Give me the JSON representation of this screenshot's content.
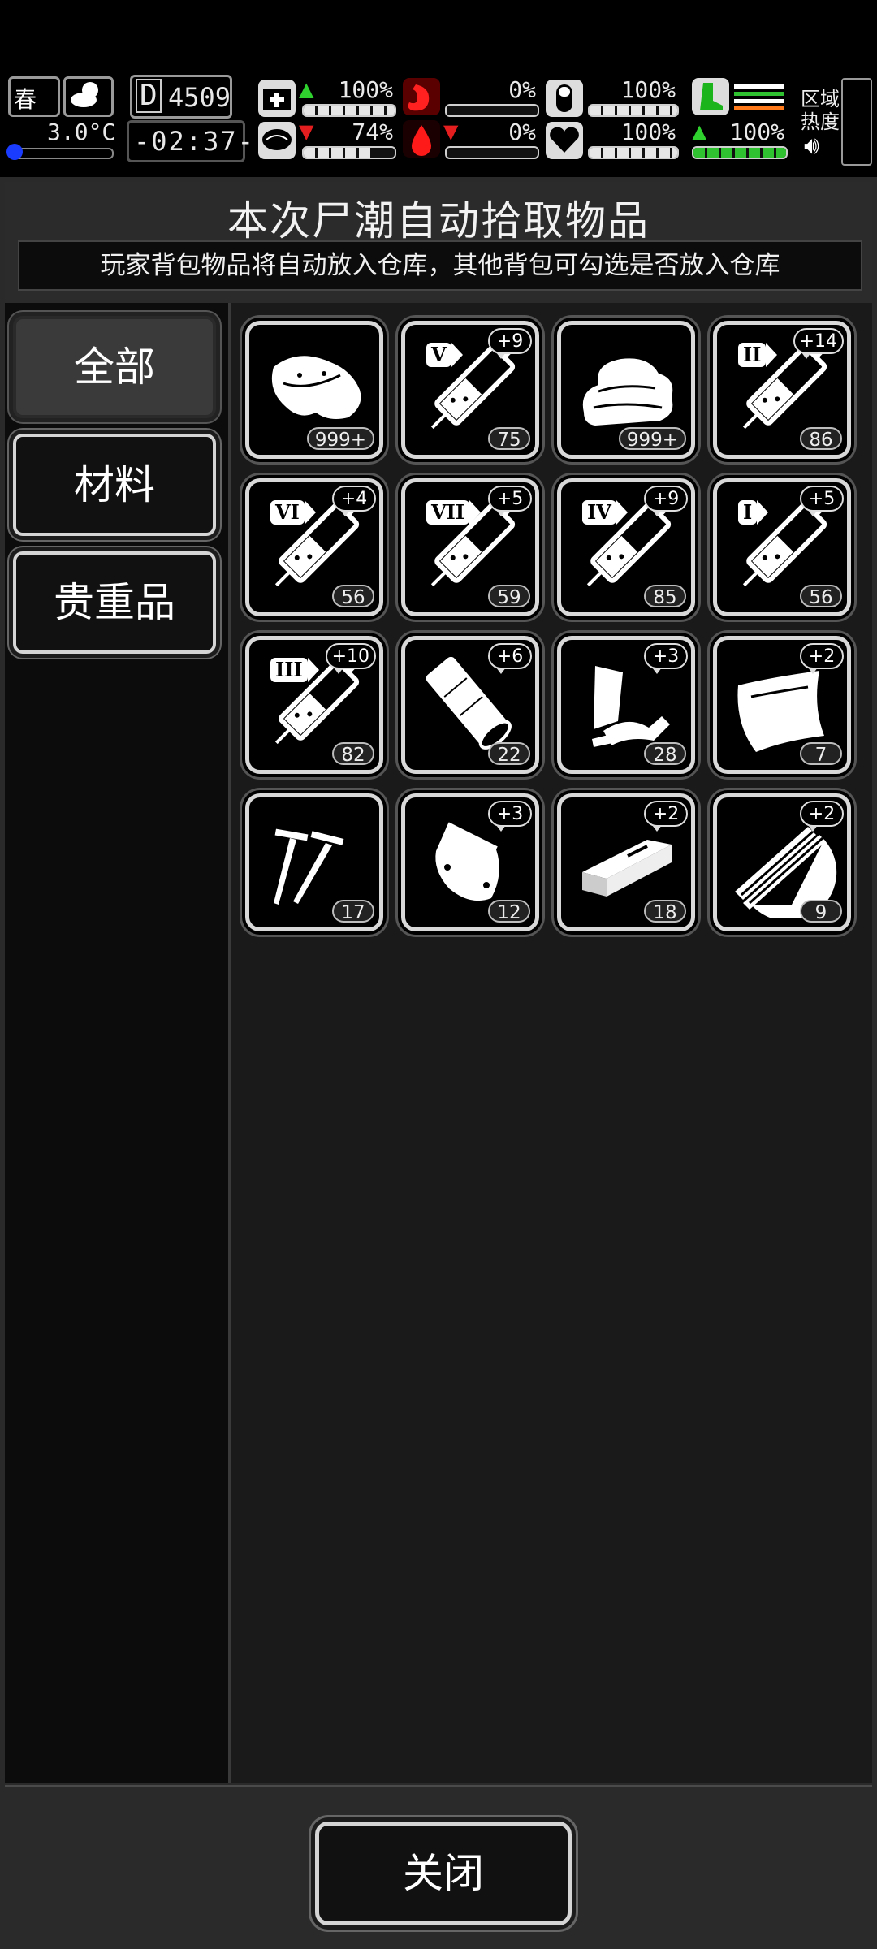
{
  "status_bar": {
    "season": "春",
    "temperature": "3.0°C",
    "day_counter": "4509",
    "day_counter_prefix": "D",
    "clock": "-02:37-",
    "health": {
      "text": "100%",
      "level": 1.0,
      "trend": "up"
    },
    "sanity": {
      "text": "74%",
      "level": 0.74,
      "trend": "down"
    },
    "hunger": {
      "text": "0%",
      "level": 0.0
    },
    "blood": {
      "text": "0%",
      "level": 0.0,
      "trend": "down"
    },
    "pill": {
      "text": "100%",
      "level": 1.0
    },
    "heart": {
      "text": "100%",
      "level": 1.0
    },
    "stamina": {
      "text": "100%",
      "level": 1.0,
      "trend": "up"
    },
    "zone_heat_label_1": "区域",
    "zone_heat_label_2": "热度",
    "colors": {
      "up_arrow": "#2fd12f",
      "down_arrow": "#e41e1e",
      "stamina_bar": "#2fc12f"
    }
  },
  "dialog": {
    "title": "本次尸潮自动拾取物品",
    "subtitle": "玩家背包物品将自动放入仓库，其他背包可勾选是否放入仓库"
  },
  "categories": [
    {
      "label": "全部",
      "active": true
    },
    {
      "label": "材料",
      "active": false
    },
    {
      "label": "贵重品",
      "active": false
    }
  ],
  "items": [
    {
      "icon": "meat-icon",
      "qty": "999+",
      "bonus": "",
      "tier": ""
    },
    {
      "icon": "syringe-icon",
      "qty": "75",
      "bonus": "+9",
      "tier": "V"
    },
    {
      "icon": "cloth-icon",
      "qty": "999+",
      "bonus": "",
      "tier": ""
    },
    {
      "icon": "syringe-icon",
      "qty": "86",
      "bonus": "+14",
      "tier": "II"
    },
    {
      "icon": "syringe-icon",
      "qty": "56",
      "bonus": "+4",
      "tier": "VI"
    },
    {
      "icon": "syringe-icon",
      "qty": "59",
      "bonus": "+5",
      "tier": "VII"
    },
    {
      "icon": "syringe-icon",
      "qty": "85",
      "bonus": "+9",
      "tier": "IV"
    },
    {
      "icon": "syringe-icon",
      "qty": "56",
      "bonus": "+5",
      "tier": "I"
    },
    {
      "icon": "syringe-icon",
      "qty": "82",
      "bonus": "+10",
      "tier": "III"
    },
    {
      "icon": "bandage-icon",
      "qty": "22",
      "bonus": "+6",
      "tier": ""
    },
    {
      "icon": "scrap-metal-icon",
      "qty": "28",
      "bonus": "+3",
      "tier": ""
    },
    {
      "icon": "metal-sheet-icon",
      "qty": "7",
      "bonus": "+2",
      "tier": ""
    },
    {
      "icon": "nails-icon",
      "qty": "17",
      "bonus": "",
      "tier": ""
    },
    {
      "icon": "pouch-icon",
      "qty": "12",
      "bonus": "+3",
      "tier": ""
    },
    {
      "icon": "wood-board-icon",
      "qty": "18",
      "bonus": "+2",
      "tier": ""
    },
    {
      "icon": "wood-planks-icon",
      "qty": "9",
      "bonus": "+2",
      "tier": ""
    }
  ],
  "footer": {
    "close_label": "关闭"
  }
}
